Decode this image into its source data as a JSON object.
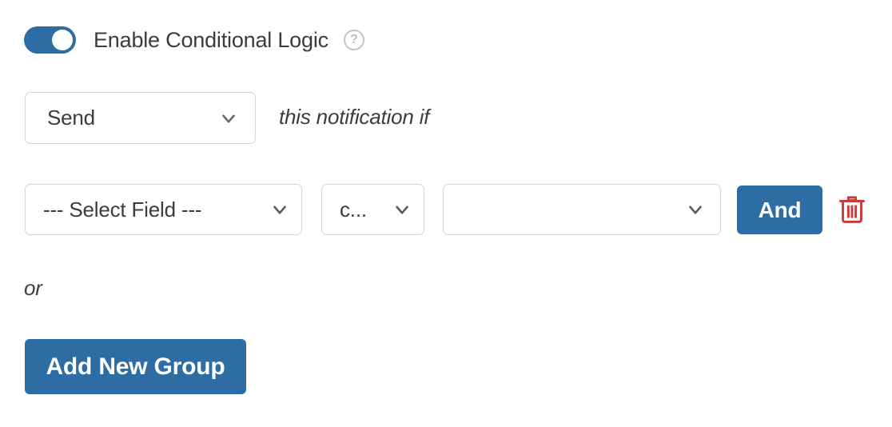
{
  "toggle": {
    "label": "Enable Conditional Logic",
    "state": "on",
    "accent_color": "#2e6da4",
    "help_glyph": "?"
  },
  "action_row": {
    "action_select": {
      "value": "Send",
      "icon": "chevron-down-icon"
    },
    "note": "this notification if"
  },
  "condition_row": {
    "field_select": {
      "value": "--- Select Field ---",
      "icon": "chevron-down-icon"
    },
    "operator_select": {
      "value": "c...",
      "icon": "chevron-down-icon"
    },
    "value_select": {
      "value": "",
      "icon": "chevron-down-icon"
    },
    "and_button": {
      "label": "And",
      "color": "#2e6da4"
    },
    "delete_button": {
      "icon": "trash-icon",
      "color": "#cc3b38"
    }
  },
  "group_separator": {
    "label": "or"
  },
  "add_group_button": {
    "label": "Add New Group",
    "color": "#2e6da4"
  }
}
